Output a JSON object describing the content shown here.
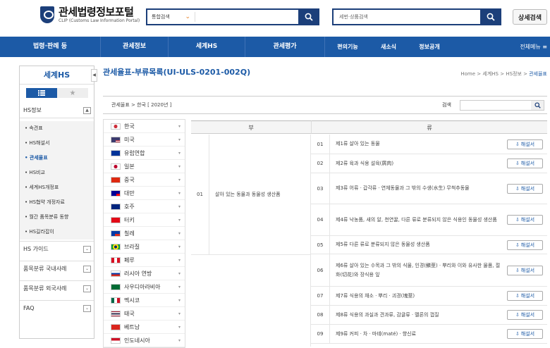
{
  "header": {
    "logo_title": "관세법령정보포털",
    "logo_sub": "CLIP (Customs Law Information Portal)",
    "search1_select": "통합검색",
    "search2_placeholder": "세번·상품검색",
    "detail_search": "상세검색"
  },
  "nav": {
    "items": [
      "법령·판례 등",
      "관세정보",
      "세계HS",
      "관세평가"
    ],
    "small_items": [
      "편의기능",
      "새소식",
      "정보공개"
    ],
    "all_menu": "전체메뉴 ≡"
  },
  "sidebar": {
    "title": "세계HS",
    "hs_info": "HS정보",
    "sub_items": [
      "• 속견표",
      "• HS해설서",
      "• 관세율표",
      "• HS비교",
      "• 세계HS개정표",
      "• HS협약 개정자료",
      "• 월간 품목분류 동향",
      "• HS길라잡이"
    ],
    "sections": [
      "HS 가이드",
      "품목분류 국내사례",
      "품목분류 외국사례",
      "FAQ"
    ]
  },
  "main": {
    "title": "관세율표-부류목록(UI-ULS-0201-002Q)",
    "breadcrumb": [
      "Home",
      "세계HS",
      "HS정보",
      "관세율표"
    ],
    "filter_path": "관세율표 > 한국 [ 2020년 ]",
    "search_label": "검색"
  },
  "countries": [
    "한국",
    "미국",
    "유럽연합",
    "일본",
    "중국",
    "대만",
    "호주",
    "터키",
    "칠레",
    "브라질",
    "페루",
    "러시아 연방",
    "사우디아라비아",
    "멕시코",
    "태국",
    "베트남",
    "인도네시아"
  ],
  "table": {
    "col_bu": "부",
    "col_ryu": "류",
    "bu_num": "01",
    "bu_name": "살아 있는 동물과 동물성 생산품",
    "button_label": "해설서",
    "rows": [
      {
        "num": "01",
        "name": "제1류 살아 있는 동물"
      },
      {
        "num": "02",
        "name": "제2류 육과 식용 설육(屑肉)"
      },
      {
        "num": "03",
        "name": "제3류 어류ㆍ갑각류ㆍ연체동물과 그 밖의 수생(水生) 무척추동물"
      },
      {
        "num": "04",
        "name": "제4류 낙농품, 새의 알, 천연꿀, 다른 류로 분류되지 않은 식용인 동물성 생산품"
      },
      {
        "num": "05",
        "name": "제5류 다른 류로 분류되지 않은 동물성 생산품"
      },
      {
        "num": "06",
        "name": "제6류 살아 있는 수목과 그 밖의 식물, 인경(鱗莖)ㆍ뿌리와 이와 유사한 물품, 절화(切花)와 장식용 잎"
      },
      {
        "num": "07",
        "name": "제7류 식용의 채소ㆍ뿌리ㆍ괴경(塊莖)"
      },
      {
        "num": "08",
        "name": "제8류 식용의 과실과 견과류, 감귤류ㆍ멜론의 껍질"
      },
      {
        "num": "09",
        "name": "제9류 커피ㆍ차ㆍ마테(maté)ㆍ향신료"
      }
    ]
  }
}
